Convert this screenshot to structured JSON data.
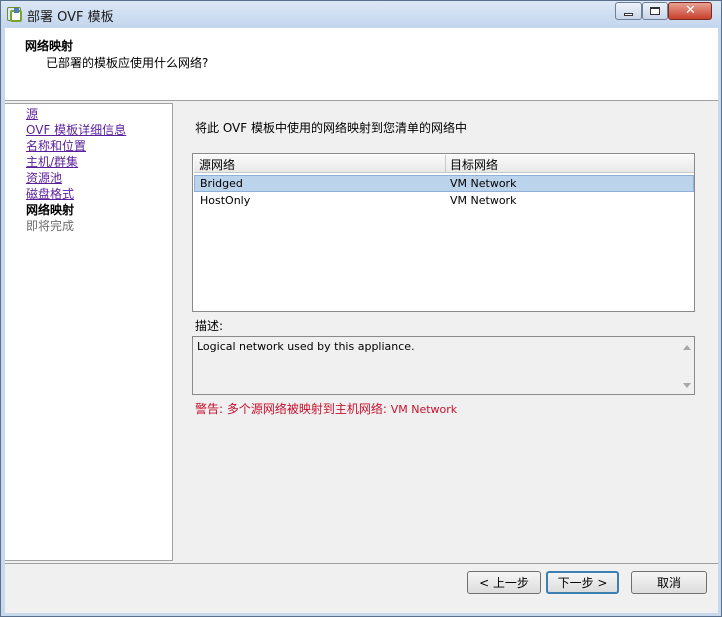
{
  "window": {
    "title": "部署 OVF 模板"
  },
  "header": {
    "title": "网络映射",
    "subtitle": "已部署的模板应使用什么网络?"
  },
  "nav": {
    "items": [
      {
        "label": "源",
        "state": "link"
      },
      {
        "label": "OVF 模板详细信息",
        "state": "link"
      },
      {
        "label": "名称和位置",
        "state": "link"
      },
      {
        "label": "主机/群集",
        "state": "link"
      },
      {
        "label": "资源池",
        "state": "link"
      },
      {
        "label": "磁盘格式",
        "state": "link"
      },
      {
        "label": "网络映射",
        "state": "current"
      },
      {
        "label": "即将完成",
        "state": "disabled"
      }
    ]
  },
  "main": {
    "instruction": "将此 OVF 模板中使用的网络映射到您清单的网络中",
    "table": {
      "columns": [
        "源网络",
        "目标网络"
      ],
      "rows": [
        {
          "source": "Bridged",
          "target": "VM Network",
          "selected": true
        },
        {
          "source": "HostOnly",
          "target": "VM Network",
          "selected": false
        }
      ]
    },
    "description_label": "描述:",
    "description": "Logical network used by this appliance.",
    "warning_prefix": "警告: 多个源网络被映射到主机网络: ",
    "warning_value": "VM Network"
  },
  "buttons": {
    "back": "< 上一步",
    "next": "下一步 >",
    "cancel": "取消"
  },
  "colors": {
    "link": "#5a1f9a",
    "warning": "#c8102e",
    "selection": "#bcd3ec"
  }
}
